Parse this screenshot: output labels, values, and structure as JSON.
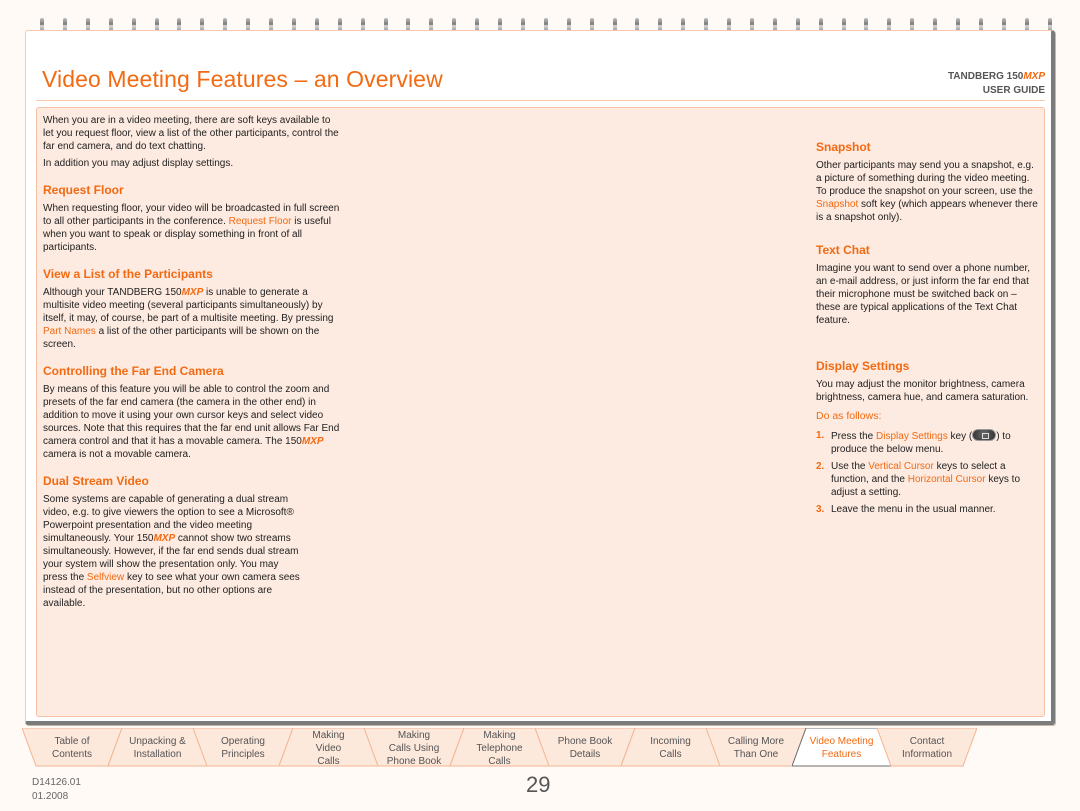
{
  "header": {
    "title": "Video Meeting Features – an Overview",
    "brand": "TANDBERG 150",
    "brand_model": "MXP",
    "guide": "USER GUIDE"
  },
  "colors": {
    "accent": "#f26a12",
    "panel": "#fdeae0",
    "border": "#f7c2a3"
  },
  "left": {
    "intro1": "When you are in a video meeting, there are soft keys available to let you request floor, view a list of the other participants, control the far end camera, and do text chatting.",
    "intro2": "In addition you may adjust display settings.",
    "request_floor": {
      "heading": "Request Floor",
      "text_a": "When requesting floor, your video will be broadcasted in full screen to all other participants in the conference. ",
      "key": "Request Floor",
      "text_b": " is useful when you want to speak or display something in front of all participants."
    },
    "participants": {
      "heading": "View a List of the Participants",
      "text_a": "Although your TANDBERG 150",
      "model": "MXP",
      "text_b": " is unable to generate a multisite video meeting (several participants simultaneously) by itself, it may, of course, be part of a multisite meeting. By pressing ",
      "key": "Part Names",
      "text_c": " a list of the other participants will be shown on the screen."
    },
    "far_end": {
      "heading": "Controlling the Far End Camera",
      "text_a": "By means of this feature you will be able to control the zoom and presets of the far end camera (the camera in the other end) in addition to move it using your own cursor keys and select video sources. Note that this requires that the far end unit allows Far End camera control and that it has a movable camera. The 150",
      "model": "MXP",
      "text_b": " camera is not a movable camera."
    },
    "dual_stream": {
      "heading": "Dual Stream Video",
      "text_a": "Some systems are capable of generating a dual stream video, e.g. to give viewers the option to see a Microsoft® Powerpoint presentation and the video meeting simultaneously. Your 150",
      "model": "MXP",
      "text_b": " cannot show two streams simultaneously. However, if the far end sends dual stream your system will show the presentation only. You may press the ",
      "key": "Selfview",
      "text_c": " key to see what your own camera sees instead of the presentation, but no other options are available."
    }
  },
  "right": {
    "snapshot": {
      "heading": "Snapshot",
      "text_a": "Other participants may send you a snapshot, e.g. a picture of something during the video meeting. To produce the snapshot on your screen, use the ",
      "key": "Snapshot",
      "text_b": " soft key (which appears whenever there is a snapshot only)."
    },
    "text_chat": {
      "heading": "Text Chat",
      "text": "Imagine you want to send over a phone number, an e-mail address, or just inform the far end that their microphone must be switched back on – these are typical applications of the Text Chat feature."
    },
    "display": {
      "heading": "Display Settings",
      "text": "You may adjust the monitor brightness, camera brightness, camera hue, and camera saturation.",
      "do_as": "Do as follows:",
      "steps": [
        {
          "num": "1.",
          "a": "Press the ",
          "key": "Display Settings",
          "b": " key (",
          "icon": "display-settings-key-icon",
          "c": ") to produce the below menu."
        },
        {
          "num": "2.",
          "a": "Use the ",
          "key": "Vertical Cursor",
          "b": " keys to select a function, and the ",
          "key2": "Horizontal Cursor",
          "c": " keys to adjust a setting."
        },
        {
          "num": "3.",
          "a": "Leave the menu in the usual manner."
        }
      ]
    }
  },
  "tabs": [
    {
      "label": "Table of\nContents",
      "active": false
    },
    {
      "label": "Unpacking &\nInstallation",
      "active": false
    },
    {
      "label": "Operating\nPrinciples",
      "active": false
    },
    {
      "label": "Making\nVideo\nCalls",
      "active": false
    },
    {
      "label": "Making\nCalls Using\nPhone Book",
      "active": false
    },
    {
      "label": "Making\nTelephone\nCalls",
      "active": false
    },
    {
      "label": "Phone Book\nDetails",
      "active": false
    },
    {
      "label": "Incoming\nCalls",
      "active": false
    },
    {
      "label": "Calling More\nThan One",
      "active": false
    },
    {
      "label": "Video Meeting\nFeatures",
      "active": true
    },
    {
      "label": "Contact\nInformation",
      "active": false
    }
  ],
  "footer": {
    "doc_id": "D14126.01",
    "date": "01.2008",
    "page": "29"
  }
}
